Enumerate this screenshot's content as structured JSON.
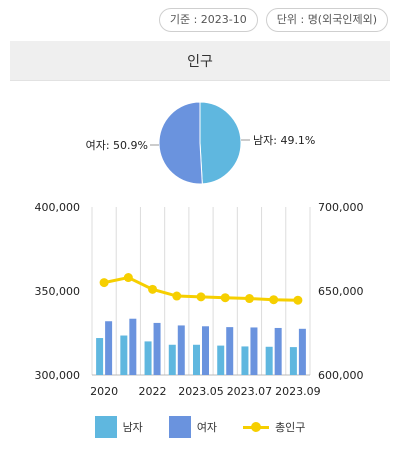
{
  "badges": {
    "reference": "기준 : 2023-10",
    "unit": "단위 : 명(외국인제외)"
  },
  "header": {
    "title": "인구"
  },
  "colors": {
    "male": "#5fb7df",
    "female": "#6a93de",
    "total": "#f6cf00",
    "grid": "#dcdcdc"
  },
  "chart_data": [
    {
      "type": "pie",
      "slices": [
        {
          "name": "남자",
          "label": "남자: 49.1%",
          "value": 49.1
        },
        {
          "name": "여자",
          "label": "여자: 50.9%",
          "value": 50.9
        }
      ]
    },
    {
      "type": "bar",
      "categories": [
        "2020",
        "2021",
        "2022",
        "2023.04",
        "2023.05",
        "2023.06",
        "2023.07",
        "2023.08",
        "2023.09"
      ],
      "x_tick_labels": [
        "2020",
        "2022",
        "2023.05",
        "2023.07",
        "2023.09"
      ],
      "series": [
        {
          "name": "남자",
          "axis": "left",
          "values": [
            322000,
            323500,
            320000,
            318000,
            318000,
            317500,
            317000,
            316800,
            316600
          ]
        },
        {
          "name": "여자",
          "axis": "left",
          "values": [
            332000,
            333500,
            331000,
            329500,
            329000,
            328500,
            328300,
            328000,
            327500
          ]
        },
        {
          "name": "총인구",
          "type": "line",
          "axis": "right",
          "values": [
            655000,
            658000,
            651000,
            647000,
            646500,
            646000,
            645500,
            644800,
            644500
          ]
        }
      ],
      "ylim_left": [
        300000,
        400000
      ],
      "ylim_right": [
        600000,
        700000
      ],
      "yticks_left": [
        "300,000",
        "350,000",
        "400,000"
      ],
      "yticks_right": [
        "600,000",
        "650,000",
        "700,000"
      ],
      "legend": [
        "남자",
        "여자",
        "총인구"
      ],
      "legend_position": "bottom",
      "grid": "vertical"
    }
  ]
}
